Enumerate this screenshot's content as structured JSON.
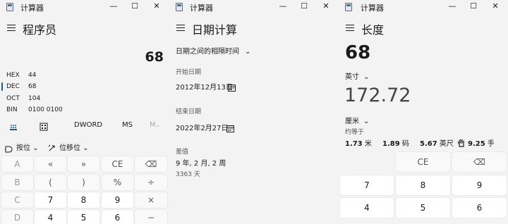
{
  "app": {
    "window_title": "计算器"
  },
  "window_controls": {
    "minimize": "—",
    "maximize": "☐",
    "close": "✕"
  },
  "programmer": {
    "mode_title": "程序员",
    "display_value": "68",
    "radix": [
      {
        "label": "HEX",
        "value": "44"
      },
      {
        "label": "DEC",
        "value": "68"
      },
      {
        "label": "OCT",
        "value": "104"
      },
      {
        "label": "BIN",
        "value": "0100 0100"
      }
    ],
    "word_size": "DWORD",
    "memory_store": "MS",
    "memory_recall": "M",
    "bitwise_label": "按位",
    "bitshift_label": "位移位",
    "keys": [
      [
        "A",
        "«",
        "»",
        "CE",
        "⌫"
      ],
      [
        "B",
        "(",
        ")",
        "%",
        "÷"
      ],
      [
        "C",
        "7",
        "8",
        "9",
        "×"
      ],
      [
        "D",
        "4",
        "5",
        "6",
        "−"
      ]
    ]
  },
  "date": {
    "mode_title": "日期计算",
    "calc_type": "日期之间的相隔时间",
    "start_label": "开始日期",
    "start_value": "2012年12月13日",
    "end_label": "结束日期",
    "end_value": "2022年2月27日",
    "diff_label": "差值",
    "diff_value": "9 年, 2 月, 2 周",
    "diff_days": "3363 天"
  },
  "length": {
    "mode_title": "长度",
    "input_value": "68",
    "input_unit": "英寸",
    "output_value": "172.72",
    "output_unit": "厘米",
    "approx_label": "约等于",
    "approx": [
      {
        "value": "1.73",
        "unit": "米"
      },
      {
        "value": "1.89",
        "unit": "码"
      },
      {
        "value": "5.67",
        "unit": "英尺"
      },
      {
        "value": "9.25",
        "unit": "手"
      }
    ],
    "keys": [
      [
        "",
        "CE",
        "⌫"
      ],
      [
        "7",
        "8",
        "9"
      ],
      [
        "4",
        "5",
        "6"
      ]
    ]
  }
}
